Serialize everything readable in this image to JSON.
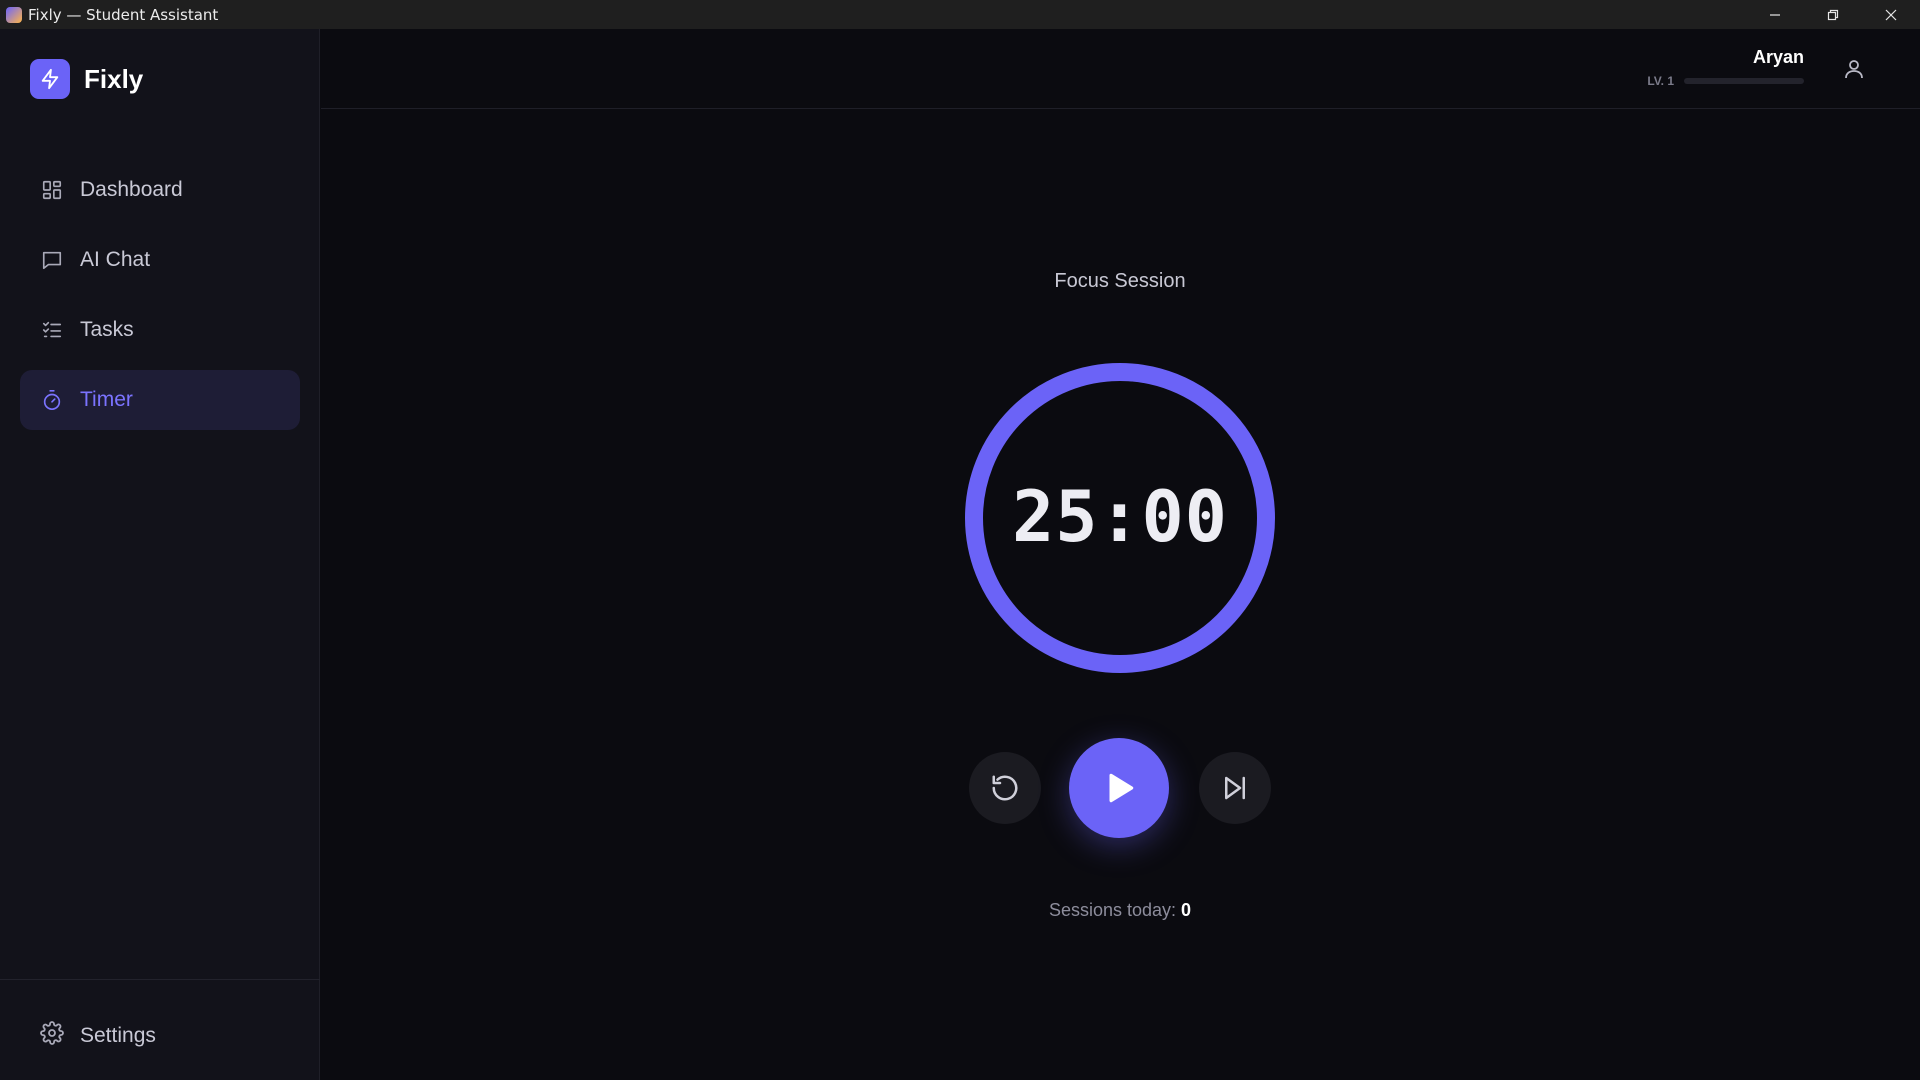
{
  "window": {
    "title": "Fixly — Student Assistant"
  },
  "brand": {
    "name": "Fixly"
  },
  "sidebar": {
    "items": [
      {
        "label": "Dashboard",
        "icon": "dashboard-icon",
        "active": false
      },
      {
        "label": "AI Chat",
        "icon": "chat-icon",
        "active": false
      },
      {
        "label": "Tasks",
        "icon": "tasks-icon",
        "active": false
      },
      {
        "label": "Timer",
        "icon": "timer-icon",
        "active": true
      }
    ],
    "settings_label": "Settings"
  },
  "header": {
    "user_name": "Aryan",
    "level_label": "LV. 1",
    "xp_progress": 0
  },
  "timer": {
    "mode_label": "Focus Session",
    "time": "25:00",
    "sessions_label": "Sessions today:",
    "sessions_count": "0"
  },
  "colors": {
    "accent": "#6b63f7",
    "background": "#0b0b10",
    "sidebar_bg": "#12121a"
  }
}
